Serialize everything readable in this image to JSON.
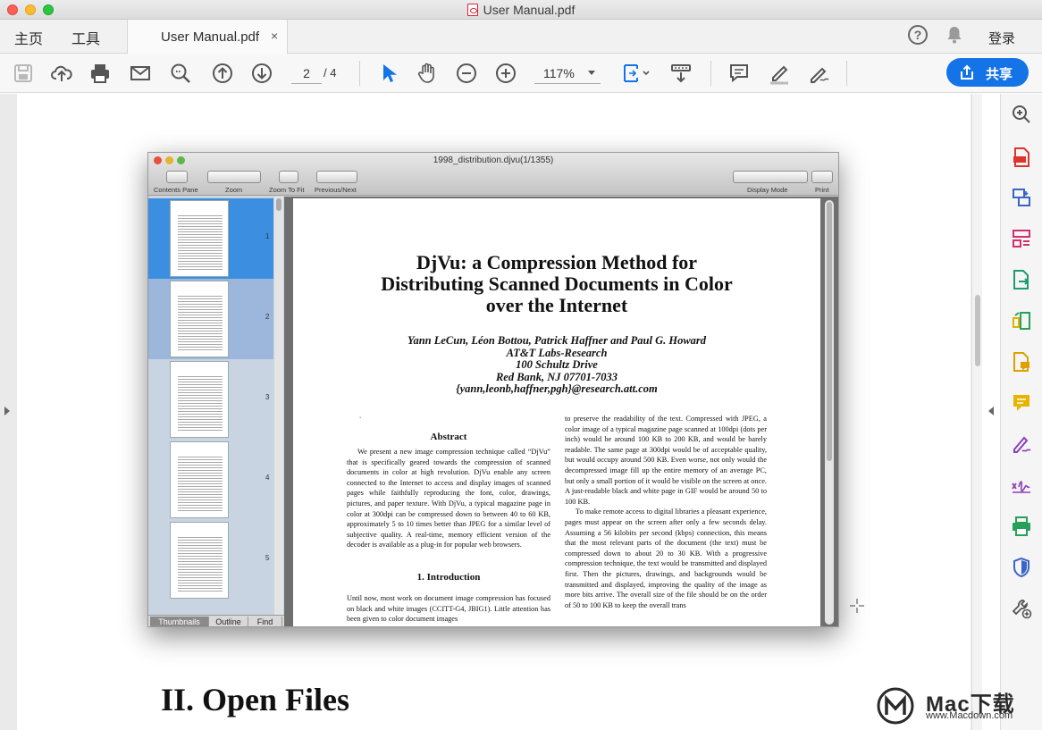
{
  "window": {
    "title": "User Manual.pdf"
  },
  "menu": {
    "home": "主页",
    "tools": "工具",
    "login": "登录"
  },
  "tab": {
    "label": "User Manual.pdf",
    "close": "×"
  },
  "toolbar": {
    "page_current": "2",
    "page_total": "/ 4",
    "zoom": "117%",
    "share_label": "共享",
    "accent_color": "#1473e6"
  },
  "embedded": {
    "window_title": "1998_distribution.djvu(1/1355)",
    "toolbar_labels": {
      "contents_pane": "Contents Pane",
      "zoom": "Zoom",
      "zoom_to_fit": "Zoom To Fit",
      "prev_next": "Previous/Next",
      "display_mode": "Display Mode",
      "print": "Print"
    },
    "thumbnails": [
      "1",
      "2",
      "3",
      "4",
      "5"
    ],
    "sidebar_tabs": [
      "Thumbnails",
      "Outline",
      "Find"
    ],
    "paper": {
      "title_line1": "DjVu: a Compression Method for",
      "title_line2": "Distributing Scanned Documents in Color",
      "title_line3": "over the Internet",
      "authors": "Yann LeCun, Léon Bottou, Patrick Haffner and Paul G. Howard",
      "affiliation": "AT&T Labs-Research",
      "street": "100 Schultz Drive",
      "city": "Red Bank, NJ 07701-7033",
      "emails": "{yann,leonb,haffner,pgh}@research.att.com",
      "stray_mark": "ʻ",
      "abstract_heading": "Abstract",
      "abstract_text": "We present a new image compression technique called “DjVu” that is specifically geared towards the compression of scanned documents in color at high revolution. DjVu enable any screen connected to the Internet to access and display images of scanned pages while faithfully reproducing the font, color, drawings, pictures, and paper texture. With DjVu, a typical magazine page in color at 300dpi can be compressed down to between 40 to 60 KB, approximately 5 to 10 times better than JPEG for a similar level of subjective quality. A real-time, memory efficient version of the decoder is available as a plug-in for popular web browsers.",
      "intro_heading": "1.  Introduction",
      "intro_text": "Until now, most work on document image compression has focused on black and white images (CCITT-G4, JBIG1). Little attention has been given to color document images",
      "right_col_p1": "to preserve the readability of the text. Compressed with JPEG, a color image of a typical magazine page scanned at 100dpi (dots per inch) would be around 100 KB to 200 KB, and would be barely readable. The same page at 300dpi would be of acceptable quality, but would occupy around 500 KB. Even worse, not only would the decompressed image fill up the entire memory of an average PC, but only a small portion of it would be visible on the screen at once. A just-readable black and white page in GIF would be around 50 to 100 KB.",
      "right_col_p2": "To make remote access to digital libraries a pleasant experience, pages must appear on the screen after only a few seconds delay. Assuming a 56 kilobits per second (kbps) connection, this means that the most relevant parts of the document (the text) must be compressed down to about 20 to 30 KB. With a progressive compression technique, the text would be transmitted and displayed first. Then the pictures, drawings, and backgrounds would be transmitted and displayed, improving the quality of the image as more bits arrive. The overall size of the file should be on the order of 50 to 100 KB to keep the overall trans"
    }
  },
  "document": {
    "section_heading": "II. Open Files"
  },
  "watermark": {
    "text": "Mac下载",
    "url": "www.Macdown.com"
  }
}
